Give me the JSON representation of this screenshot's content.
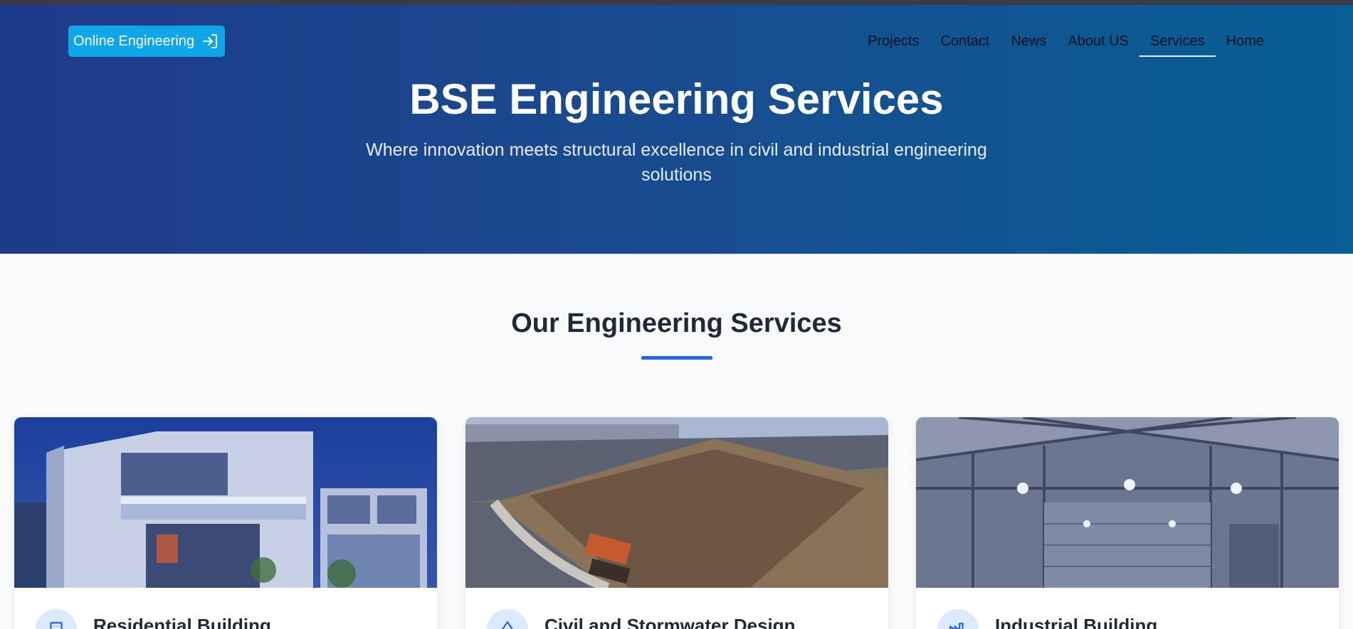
{
  "header": {
    "cta_label": "Online Engineering",
    "nav": [
      "Projects",
      "Contact",
      "News",
      "About US",
      "Services",
      "Home"
    ],
    "active_nav": "Services"
  },
  "hero": {
    "title": "BSE Engineering Services",
    "subtitle": "Where innovation meets structural excellence in civil and industrial engineering solutions"
  },
  "services": {
    "title": "Our Engineering Services",
    "cards": [
      {
        "title": "Residential Building",
        "icon": "building-icon"
      },
      {
        "title": "Civil and Stormwater Design",
        "icon": "drop-icon"
      },
      {
        "title": "Industrial Building",
        "icon": "factory-icon"
      }
    ]
  },
  "colors": {
    "accent": "#2563eb",
    "cta": "#0ea5e9",
    "hero_start": "#1e3a8a",
    "hero_end": "#075f94"
  }
}
